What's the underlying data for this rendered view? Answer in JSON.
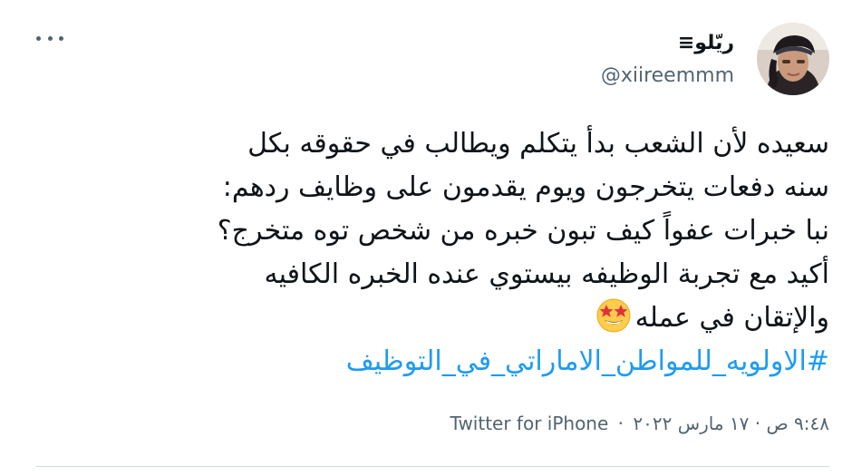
{
  "tweet": {
    "author": {
      "display_name": "ريّلو≡",
      "handle": "@xiireemmm"
    },
    "body_lines": [
      "سعيده لأن الشعب بدأ يتكلم ويطالب في حقوقه بكل",
      "سنه دفعات يتخرجون ويوم يقدمون على وظايف ردهم:",
      "نبا خبرات عفواً كيف تبون خبره من شخص توه متخرج؟",
      "أكيد مع تجربة الوظيفه بيستوي عنده الخبره الكافيه",
      "والإتقان في عمله"
    ],
    "hashtag": "#الاولويه_للمواطن_الاماراتي_في_التوظيف",
    "timestamp": "٩:٤٨ ص · ١٧ مارس ٢٠٢٢",
    "separator": "·",
    "source": "Twitter for iPhone",
    "icons": {
      "more": "more-horizontal-icon",
      "emoji": "star-struck-emoji"
    },
    "colors": {
      "link": "#1d9bf0",
      "secondary_text": "#536471",
      "primary_text": "#0f1419",
      "divider": "#cfd9de"
    }
  }
}
